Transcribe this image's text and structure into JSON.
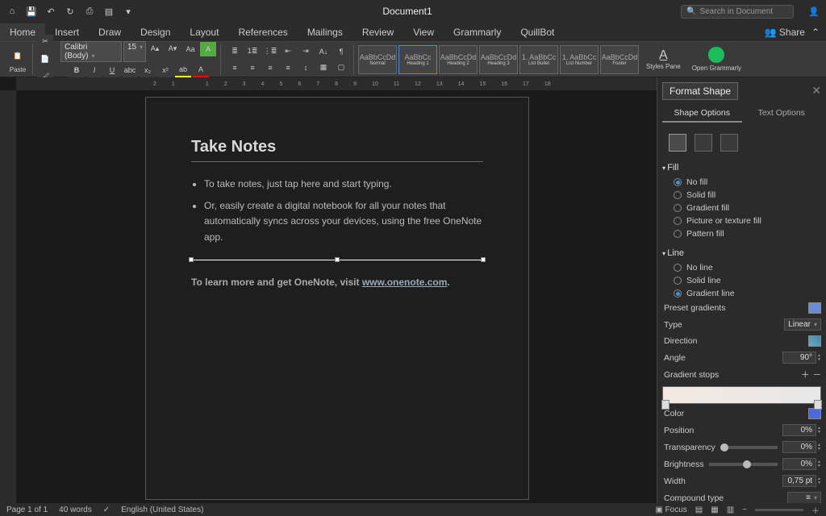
{
  "titlebar": {
    "doc_title": "Document1",
    "search_placeholder": "Search in Document"
  },
  "tabs": [
    "Home",
    "Insert",
    "Draw",
    "Design",
    "Layout",
    "References",
    "Mailings",
    "Review",
    "View",
    "Grammarly",
    "QuillBot"
  ],
  "active_tab": 0,
  "share_label": "Share",
  "ribbon": {
    "paste_label": "Paste",
    "font_name": "Calibri (Body)",
    "font_size": "15",
    "styles": [
      {
        "sample": "AaBbCcDd",
        "name": "Normal"
      },
      {
        "sample": "AaBbCc",
        "name": "Heading 1"
      },
      {
        "sample": "AaBbCcDd",
        "name": "Heading 2"
      },
      {
        "sample": "AaBbCcDd",
        "name": "Heading 3"
      },
      {
        "sample": "1. AaBbCc",
        "name": "List Bullet"
      },
      {
        "sample": "1. AaBbCc",
        "name": "List Number"
      },
      {
        "sample": "AaBbCcDd",
        "name": "Footer"
      }
    ],
    "styles_pane": "Styles Pane",
    "open_grammarly": "Open Grammarly"
  },
  "ruler_marks": [
    "2",
    "1",
    "",
    "1",
    "2",
    "3",
    "4",
    "5",
    "6",
    "7",
    "8",
    "9",
    "10",
    "11",
    "12",
    "13",
    "14",
    "15",
    "16",
    "17",
    "18",
    "1"
  ],
  "document": {
    "heading": "Take Notes",
    "bullets": [
      "To take notes, just tap here and start typing.",
      "Or, easily create a digital notebook for all your notes that automatically syncs across your devices, using the free OneNote app."
    ],
    "learn_prefix": "To learn more and get OneNote, visit ",
    "learn_link": "www.onenote.com",
    "learn_suffix": "."
  },
  "pane": {
    "title": "Format Shape",
    "tab_shape": "Shape Options",
    "tab_text": "Text Options",
    "fill": {
      "header": "Fill",
      "options": [
        "No fill",
        "Solid fill",
        "Gradient fill",
        "Picture or texture fill",
        "Pattern fill"
      ],
      "selected": 0
    },
    "line": {
      "header": "Line",
      "options": [
        "No line",
        "Solid line",
        "Gradient line"
      ],
      "selected": 2,
      "preset_label": "Preset gradients",
      "type_label": "Type",
      "type_value": "Linear",
      "direction_label": "Direction",
      "angle_label": "Angle",
      "angle_value": "90°",
      "stops_label": "Gradient stops",
      "color_label": "Color",
      "position_label": "Position",
      "position_value": "0%",
      "transparency_label": "Transparency",
      "transparency_value": "0%",
      "brightness_label": "Brightness",
      "brightness_value": "0%",
      "width_label": "Width",
      "width_value": "0,75 pt",
      "compound_label": "Compound type"
    }
  },
  "status": {
    "page": "Page 1 of 1",
    "words": "40 words",
    "lang": "English (United States)",
    "focus": "Focus"
  }
}
